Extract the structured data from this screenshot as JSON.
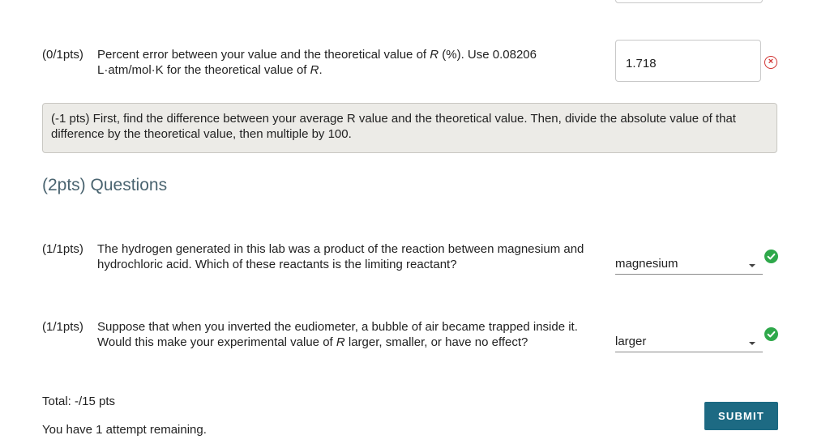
{
  "percent_error_question": {
    "score": "(0/1pts)",
    "text_part1": "Percent error between your value and the theoretical value of ",
    "text_var1": "R",
    "text_part2": " (%). Use 0.08206 L·atm/mol·K for the theoretical value of ",
    "text_var2": "R",
    "text_part3": ".",
    "answer_value": "1.718",
    "status": "incorrect"
  },
  "hint": {
    "text": "(-1 pts) First, find the difference between your average R value and the theoretical value. Then, divide the absolute value of that difference by the theoretical value, then multiple by 100."
  },
  "section": {
    "title": "(2pts) Questions"
  },
  "questions": [
    {
      "score": "(1/1pts)",
      "text": "The hydrogen generated in this lab was a product of the reaction between magnesium and hydrochloric acid. Which of these reactants is the limiting reactant?",
      "selected": "magnesium",
      "status": "correct"
    },
    {
      "score": "(1/1pts)",
      "text_part1": "Suppose that when you inverted the eudiometer, a bubble of air became trapped inside it. Would this make your experimental value of ",
      "text_var": "R",
      "text_part2": " larger, smaller, or have no effect?",
      "selected": "larger",
      "status": "correct"
    }
  ],
  "footer": {
    "total": "Total: -/15 pts",
    "attempts": "You have 1 attempt remaining.",
    "submit_label": "SUBMIT"
  },
  "colors": {
    "accent": "#1d6a83",
    "correct": "#2ea84a",
    "incorrect": "#d0302f",
    "hint_bg": "#ecebe7",
    "section_title": "#4a6470"
  },
  "icons": {
    "incorrect": "x-circle-icon",
    "correct": "check-circle-icon",
    "dropdown": "caret-down-icon"
  }
}
